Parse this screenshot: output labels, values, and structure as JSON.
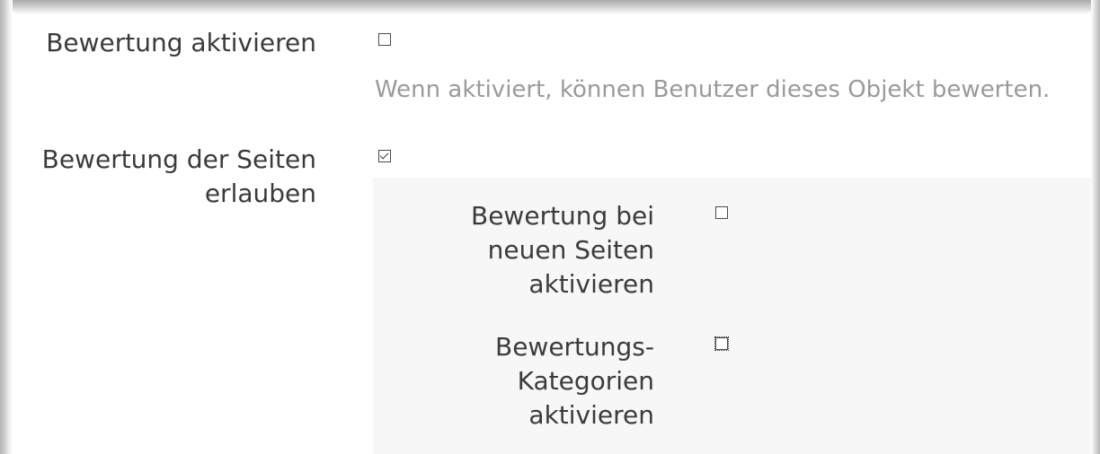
{
  "settings": {
    "rating_enable": {
      "label": "Bewertung aktivieren",
      "checked": false,
      "help": "Wenn aktiviert, können Benutzer dieses Objekt bewerten."
    },
    "page_rating": {
      "label_line1": "Bewertung der Seiten",
      "label_line2": "erlauben",
      "checked": true,
      "sub": {
        "new_pages": {
          "label_line1": "Bewertung bei",
          "label_line2": "neuen Seiten",
          "label_line3": "aktivieren",
          "checked": false
        },
        "categories": {
          "label_line1": "Bewertungs-",
          "label_line2": "Kategorien",
          "label_line3": "aktivieren",
          "checked": false
        }
      }
    }
  }
}
